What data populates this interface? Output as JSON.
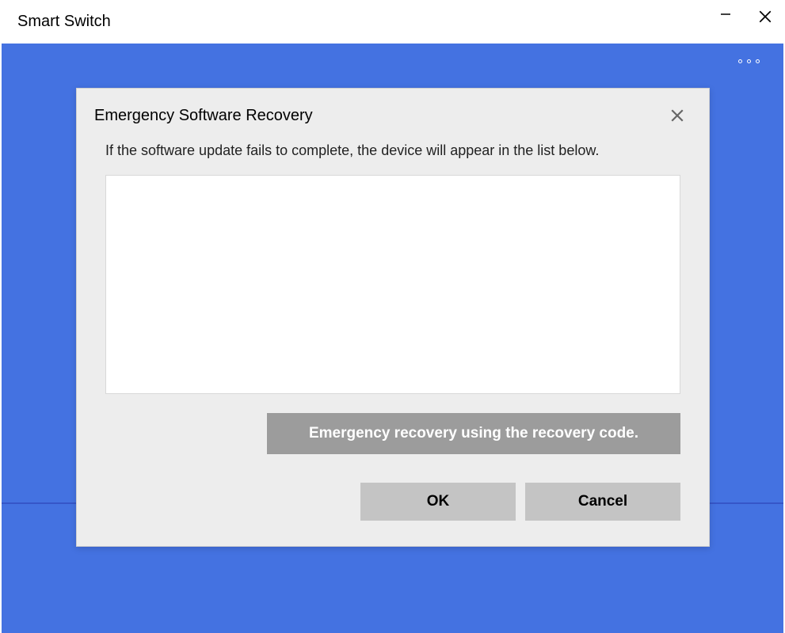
{
  "window": {
    "title": "Smart Switch"
  },
  "dialog": {
    "title": "Emergency Software Recovery",
    "message": "If the software update fails to complete, the device will appear in the list below.",
    "recovery_button": "Emergency recovery using the recovery code.",
    "ok_label": "OK",
    "cancel_label": "Cancel"
  }
}
